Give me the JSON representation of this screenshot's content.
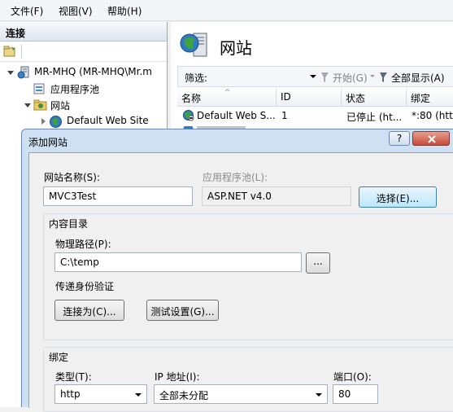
{
  "menubar": {
    "items": [
      "文件(F)",
      "视图(V)",
      "帮助(H)"
    ]
  },
  "connections": {
    "title": "连接",
    "tree": {
      "server": "MR-MHQ (MR-MHQ\\Mr.m",
      "app_pools": "应用程序池",
      "sites": "网站",
      "default_site": "Default Web Site"
    }
  },
  "sites_panel": {
    "title": "网站",
    "filter_label": "筛选:",
    "start_label": "开始(G)",
    "show_all_label": "全部显示(A)",
    "columns": [
      "名称",
      "ID",
      "状态",
      "绑定"
    ],
    "rows": [
      {
        "name": "Default Web S...",
        "id": "1",
        "status": "已停止 (ht...",
        "binding": "*:80 (http"
      }
    ]
  },
  "dialog": {
    "title": "添加网站",
    "help_label": "?",
    "site_name_label": "网站名称(S):",
    "site_name_value": "MVC3Test",
    "app_pool_label": "应用程序池(L):",
    "app_pool_value": "ASP.NET v4.0",
    "select_button": "选择(E)...",
    "content_dir": {
      "group_title": "内容目录",
      "physical_path_label": "物理路径(P):",
      "physical_path_value": "C:\\temp",
      "browse_button": "...",
      "pass_through_label": "传递身份验证",
      "connect_as_button": "连接为(C)...",
      "test_settings_button": "测试设置(G)..."
    },
    "binding": {
      "group_title": "绑定",
      "type_label": "类型(T):",
      "type_value": "http",
      "ip_label": "IP 地址(I):",
      "ip_value": "全部未分配",
      "port_label": "端口(O):",
      "port_value": "80"
    }
  },
  "colors": {
    "close_button": "#c75050",
    "dialog_frame": "#cfe0f2",
    "accent": "#3c7fb1"
  }
}
